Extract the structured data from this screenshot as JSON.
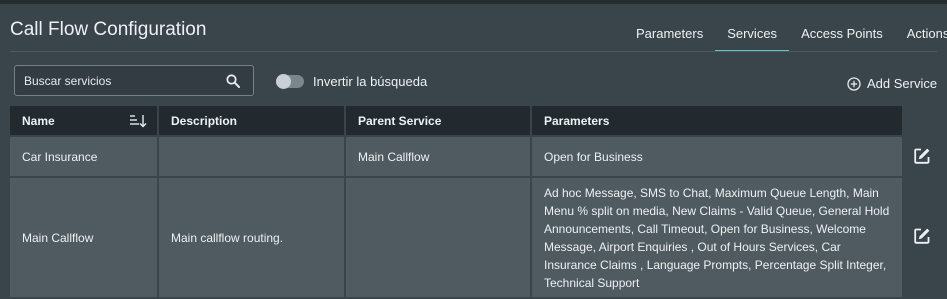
{
  "header": {
    "title": "Call Flow Configuration",
    "tabs": [
      {
        "label": "Parameters",
        "active": false
      },
      {
        "label": "Services",
        "active": true
      },
      {
        "label": "Access Points",
        "active": false
      },
      {
        "label": "Actions",
        "active": false
      }
    ]
  },
  "toolbar": {
    "search_placeholder": "Buscar servicios",
    "search_value": "",
    "toggle_label": "Invertir la búsqueda",
    "toggle_on": false,
    "add_label": "Add Service"
  },
  "table": {
    "columns": [
      "Name",
      "Description",
      "Parent Service",
      "Parameters"
    ],
    "rows": [
      {
        "name": "Car Insurance",
        "description": "",
        "parent": "Main Callflow",
        "parameters": "Open for Business"
      },
      {
        "name": "Main Callflow",
        "description": "Main callflow routing.",
        "parent": "",
        "parameters": "Ad hoc Message, SMS to Chat, Maximum Queue Length, Main Menu % split on media, New Claims - Valid Queue, General Hold Announcements, Call Timeout, Open for Business, Welcome Message, Airport Enquiries , Out of Hours Services, Car Insurance Claims , Language Prompts, Percentage Split Integer, Technical Support"
      }
    ]
  },
  "icons": {
    "search": "search-icon",
    "add": "plus-circle-icon",
    "sort": "sort-descending-icon",
    "edit": "edit-icon"
  },
  "colors": {
    "background": "#3a444b",
    "header_row": "#222a2f",
    "data_row": "#4f5a61",
    "accent": "#5cc3cf"
  }
}
